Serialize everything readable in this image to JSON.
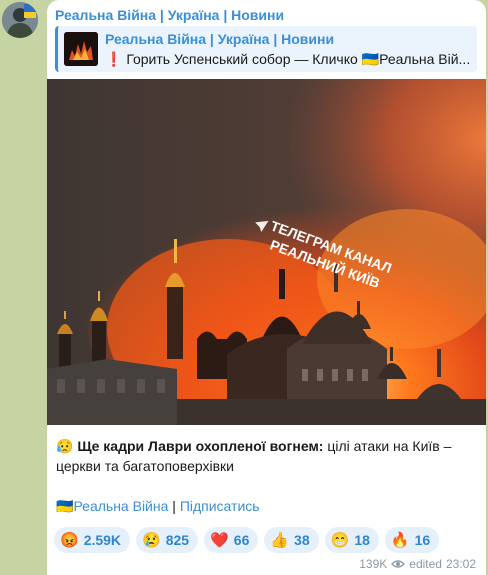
{
  "channel": {
    "name": "Реальна Війна | Україна | Новини"
  },
  "reply": {
    "title": "Реальна Війна | Україна | Новини",
    "exclamation": "❗",
    "text": "Горить Успенський собор — Кличко 🇺🇦Реальна Вій..."
  },
  "photo": {
    "watermark_line1": "ТЕЛЕГРАМ КАНАЛ",
    "watermark_line2": "РЕАЛЬНИЙ КИЇВ"
  },
  "message": {
    "emoji": "😥",
    "bold": "Ще кадри Лаври охопленої вогнем:",
    "rest": " цілі атаки на Київ – церкви та багатоповерхівки"
  },
  "signature": {
    "flag": "🇺🇦",
    "link_channel": "Реальна Війна",
    "separator": " | ",
    "link_subscribe": "Підписатись"
  },
  "reactions": [
    {
      "emoji": "😡",
      "count": "2.59K"
    },
    {
      "emoji": "😢",
      "count": "825"
    },
    {
      "emoji": "❤️",
      "count": "66"
    },
    {
      "emoji": "👍",
      "count": "38"
    },
    {
      "emoji": "😁",
      "count": "18"
    },
    {
      "emoji": "🔥",
      "count": "16"
    }
  ],
  "meta": {
    "views": "139K",
    "edited": "edited",
    "time": "23:02"
  },
  "colors": {
    "accent": "#3a8fd6",
    "chat_bg": "#c6d4a4",
    "reaction_bg": "#e5f0fb"
  },
  "icons": {
    "views": "eye-icon"
  }
}
